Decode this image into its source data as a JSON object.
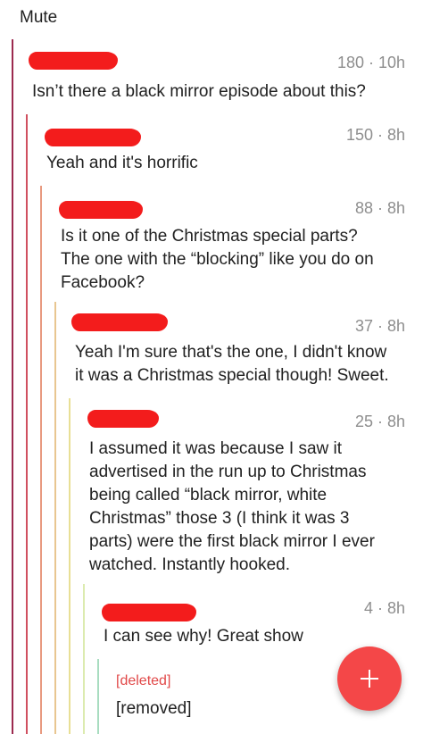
{
  "header": {
    "mute_label": "Mute"
  },
  "comments": [
    {
      "score": "180",
      "age": "10h",
      "meta": "180 · 10h",
      "body": "Isn’t there a black mirror episode about this?"
    },
    {
      "score": "150",
      "age": "8h",
      "meta": "150 · 8h",
      "body": "Yeah and it's horrific"
    },
    {
      "score": "88",
      "age": "8h",
      "meta": "88 · 8h",
      "body": "Is it one of the Christmas special parts?\nThe one with the “blocking” like you do on\nFacebook?"
    },
    {
      "score": "37",
      "age": "8h",
      "meta": "37 · 8h",
      "body": "Yeah I'm sure that's the one, I didn't know\nit was a Christmas special though! Sweet."
    },
    {
      "score": "25",
      "age": "8h",
      "meta": "25 · 8h",
      "body": "I assumed it was because I saw it\nadvertised in the run up to Christmas\nbeing called “black mirror, white\nChristmas” those 3 (I think it was 3\nparts) were the first black mirror I ever\nwatched. Instantly hooked."
    },
    {
      "score": "4",
      "age": "8h",
      "meta": "4 · 8h",
      "body": "I can see why! Great show"
    }
  ],
  "deleted_comment": {
    "author": "[deleted]",
    "body": "[removed]"
  },
  "fab": {
    "icon": "plus-icon"
  },
  "colors": {
    "redaction": "#f31c1c",
    "fab": "#f44748",
    "deleted_author": "#e14848",
    "thread_lines": [
      "#9c2a4f",
      "#d05060",
      "#e89a80",
      "#e8c690",
      "#e8df95",
      "#dcebb0",
      "#a8dcc0"
    ]
  }
}
